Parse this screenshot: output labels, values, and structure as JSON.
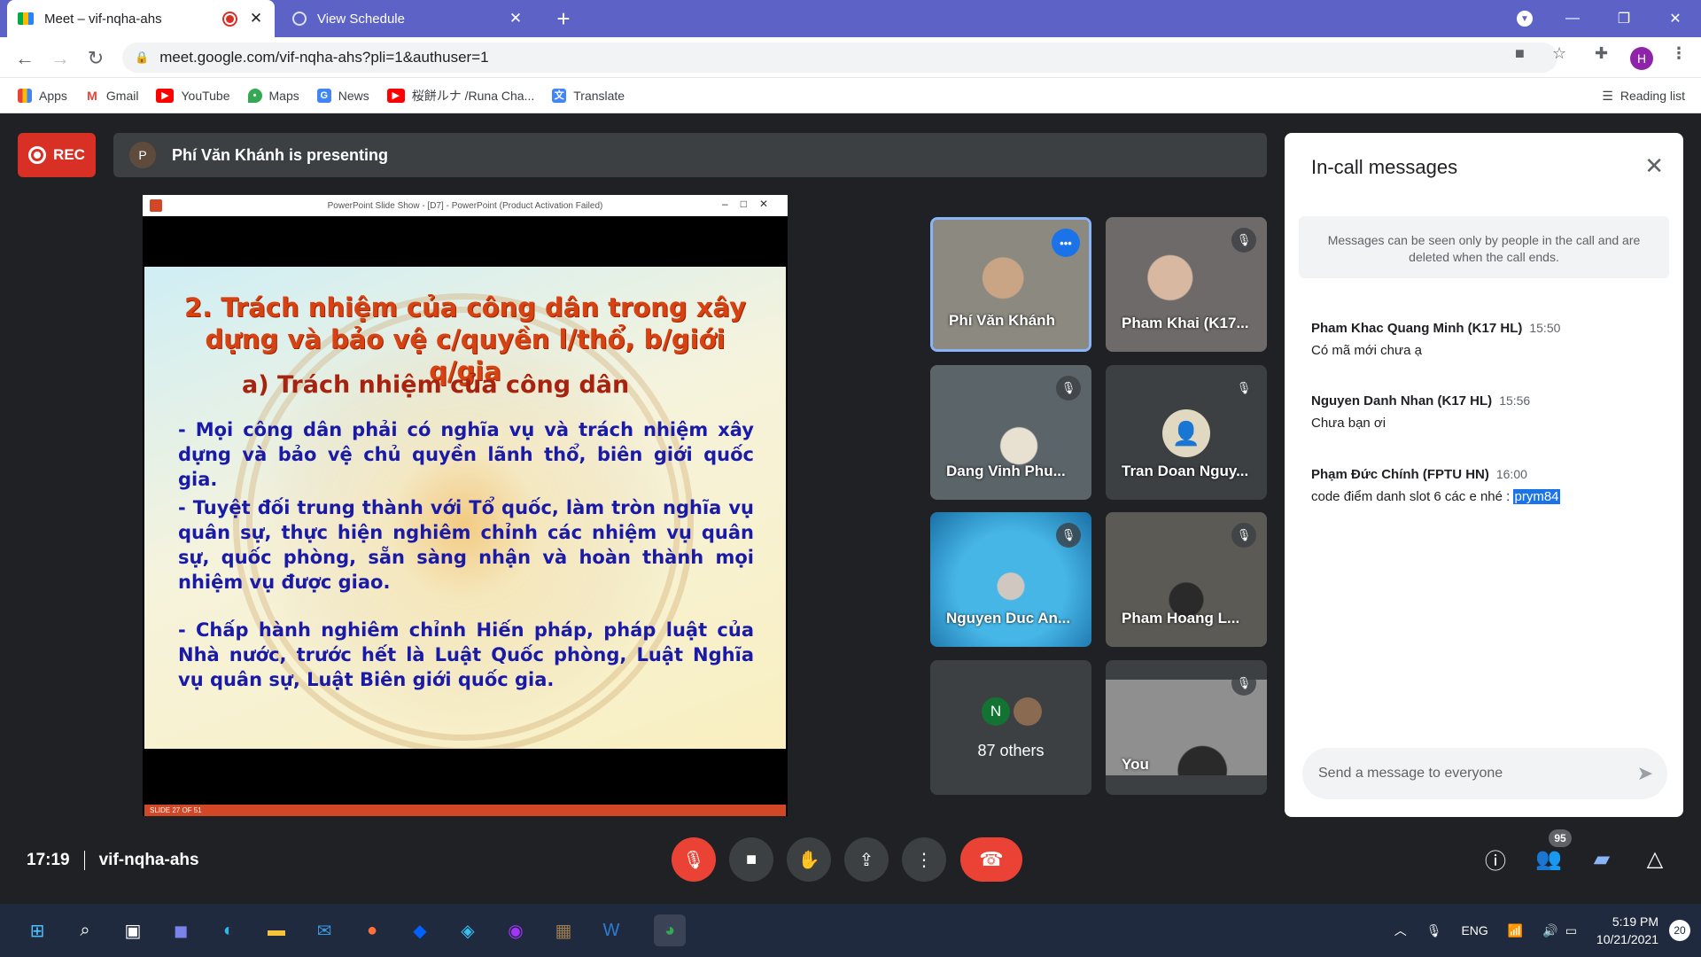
{
  "browser": {
    "tabs": [
      {
        "title": "Meet – vif-nqha-ahs",
        "active": true
      },
      {
        "title": "View Schedule",
        "active": false
      }
    ],
    "url": "meet.google.com/vif-nqha-ahs?pli=1&authuser=1",
    "profile_initial": "H",
    "bookmarks": [
      "Apps",
      "Gmail",
      "YouTube",
      "Maps",
      "News",
      "桜餅ルナ /Runa Cha...",
      "Translate"
    ],
    "reading_list": "Reading list"
  },
  "meet": {
    "rec_label": "REC",
    "presenter_initial": "P",
    "presenting_text": "Phí Văn Khánh is presenting",
    "ppt_window_title": "PowerPoint Slide Show - [D7] - PowerPoint (Product Activation Failed)",
    "slide": {
      "heading": "2. Trách nhiệm của công dân trong xây dựng và bảo vệ c/quyền l/thổ, b/giới q/gia",
      "subheading": "a) Trách nhiệm của công dân",
      "bullets": [
        "- Mọi công dân phải có nghĩa vụ và trách nhiệm xây dựng và bảo vệ chủ quyền lãnh thổ, biên giới quốc gia.",
        "- Tuyệt đối trung thành với Tổ quốc, làm tròn nghĩa vụ quân sự, thực hiện nghiêm chỉnh các nhiệm vụ quân sự, quốc phòng, sẵn sàng nhận và hoàn thành mọi nhiệm vụ được giao.",
        "- Chấp hành nghiêm chỉnh Hiến pháp, pháp luật của Nhà nước, trước hết là Luật Quốc phòng, Luật Nghĩa vụ quân sự, Luật Biên giới quốc gia."
      ],
      "status": "SLIDE 27 OF 51"
    },
    "participants": [
      {
        "name": "Phí Văn Khánh",
        "speaking": true,
        "bg": "#8c8a80"
      },
      {
        "name": "Pham Khai (K17...",
        "speaking": false,
        "bg": "#6f6a6a"
      },
      {
        "name": "Dang Vinh Phu...",
        "speaking": false,
        "bg": "#5b6468"
      },
      {
        "name": "Tran Doan Nguy...",
        "speaking": false,
        "bg": "#3c4043"
      },
      {
        "name": "Nguyen Duc An...",
        "speaking": false,
        "bg": "#2f8fc4"
      },
      {
        "name": "Pham Hoang L...",
        "speaking": false,
        "bg": "#5c5a55"
      },
      {
        "name": "87 others",
        "speaking": false,
        "bg": "#3c4043"
      },
      {
        "name": "You",
        "speaking": false,
        "bg": "#8f8f8f"
      }
    ],
    "others_initial": "N",
    "meeting_time": "17:19",
    "meeting_code": "vif-nqha-ahs",
    "participant_count": "95"
  },
  "chat": {
    "title": "In-call messages",
    "notice": "Messages can be seen only by people in the call and are deleted when the call ends.",
    "messages": [
      {
        "sender": "Pham Khac Quang Minh (K17 HL)",
        "time": "15:50",
        "text": "Có mã mới chưa ạ"
      },
      {
        "sender": "Nguyen Danh Nhan (K17 HL)",
        "time": "15:56",
        "text": "Chưa bạn ơi"
      },
      {
        "sender": "Phạm Đức Chính (FPTU HN)",
        "time": "16:00",
        "text": "code điểm danh slot 6 các e nhé : ",
        "highlight": "prym84"
      }
    ],
    "input_placeholder": "Send a message to everyone"
  },
  "taskbar": {
    "lang": "ENG",
    "time": "5:19 PM",
    "date": "10/21/2021",
    "notif_count": "20"
  },
  "colors": {
    "tabbar": "#5d63c6",
    "meet_bg": "#202124",
    "rec_red": "#d93025",
    "slide_title": "#d64211",
    "slide_body": "#1a1aa8",
    "taskbar": "#202a3f"
  }
}
